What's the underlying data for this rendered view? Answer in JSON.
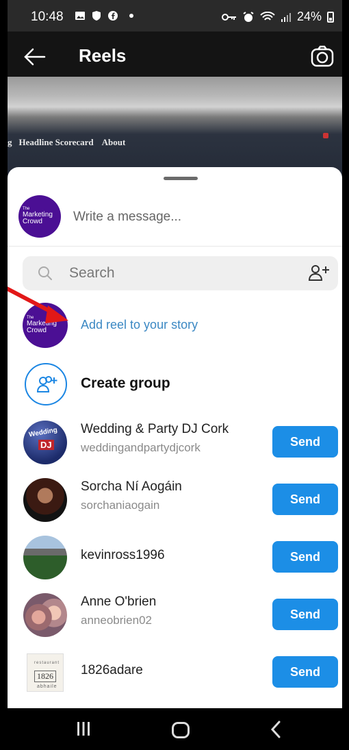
{
  "status_bar": {
    "time": "10:48",
    "battery": "24%"
  },
  "header": {
    "title": "Reels"
  },
  "video_caption": {
    "cut": "g",
    "items": [
      "Headline Scorecard",
      "About"
    ]
  },
  "message": {
    "avatar_text": [
      "The",
      "Marketing",
      "Crowd"
    ],
    "placeholder": "Write a message..."
  },
  "search": {
    "placeholder": "Search"
  },
  "story": {
    "label": "Add reel to your story"
  },
  "group": {
    "label": "Create group"
  },
  "contacts": [
    {
      "name": "Wedding & Party DJ Cork",
      "handle": "weddingandpartydjcork",
      "send": "Send",
      "avatar_text": [
        "Wedding",
        "DJ"
      ]
    },
    {
      "name": "Sorcha Ní Aogáin",
      "handle": "sorchaniaogain",
      "send": "Send"
    },
    {
      "name": "kevinross1996",
      "handle": "",
      "send": "Send"
    },
    {
      "name": "Anne O'brien",
      "handle": "anneobrien02",
      "send": "Send"
    },
    {
      "name": "1826adare",
      "handle": "",
      "send": "Send",
      "avatar_text": [
        "restaurant",
        "1826",
        "abhaile"
      ]
    }
  ],
  "colors": {
    "accent": "#1c8ee6",
    "link": "#3b88c3",
    "brand": "#4b0f94"
  }
}
